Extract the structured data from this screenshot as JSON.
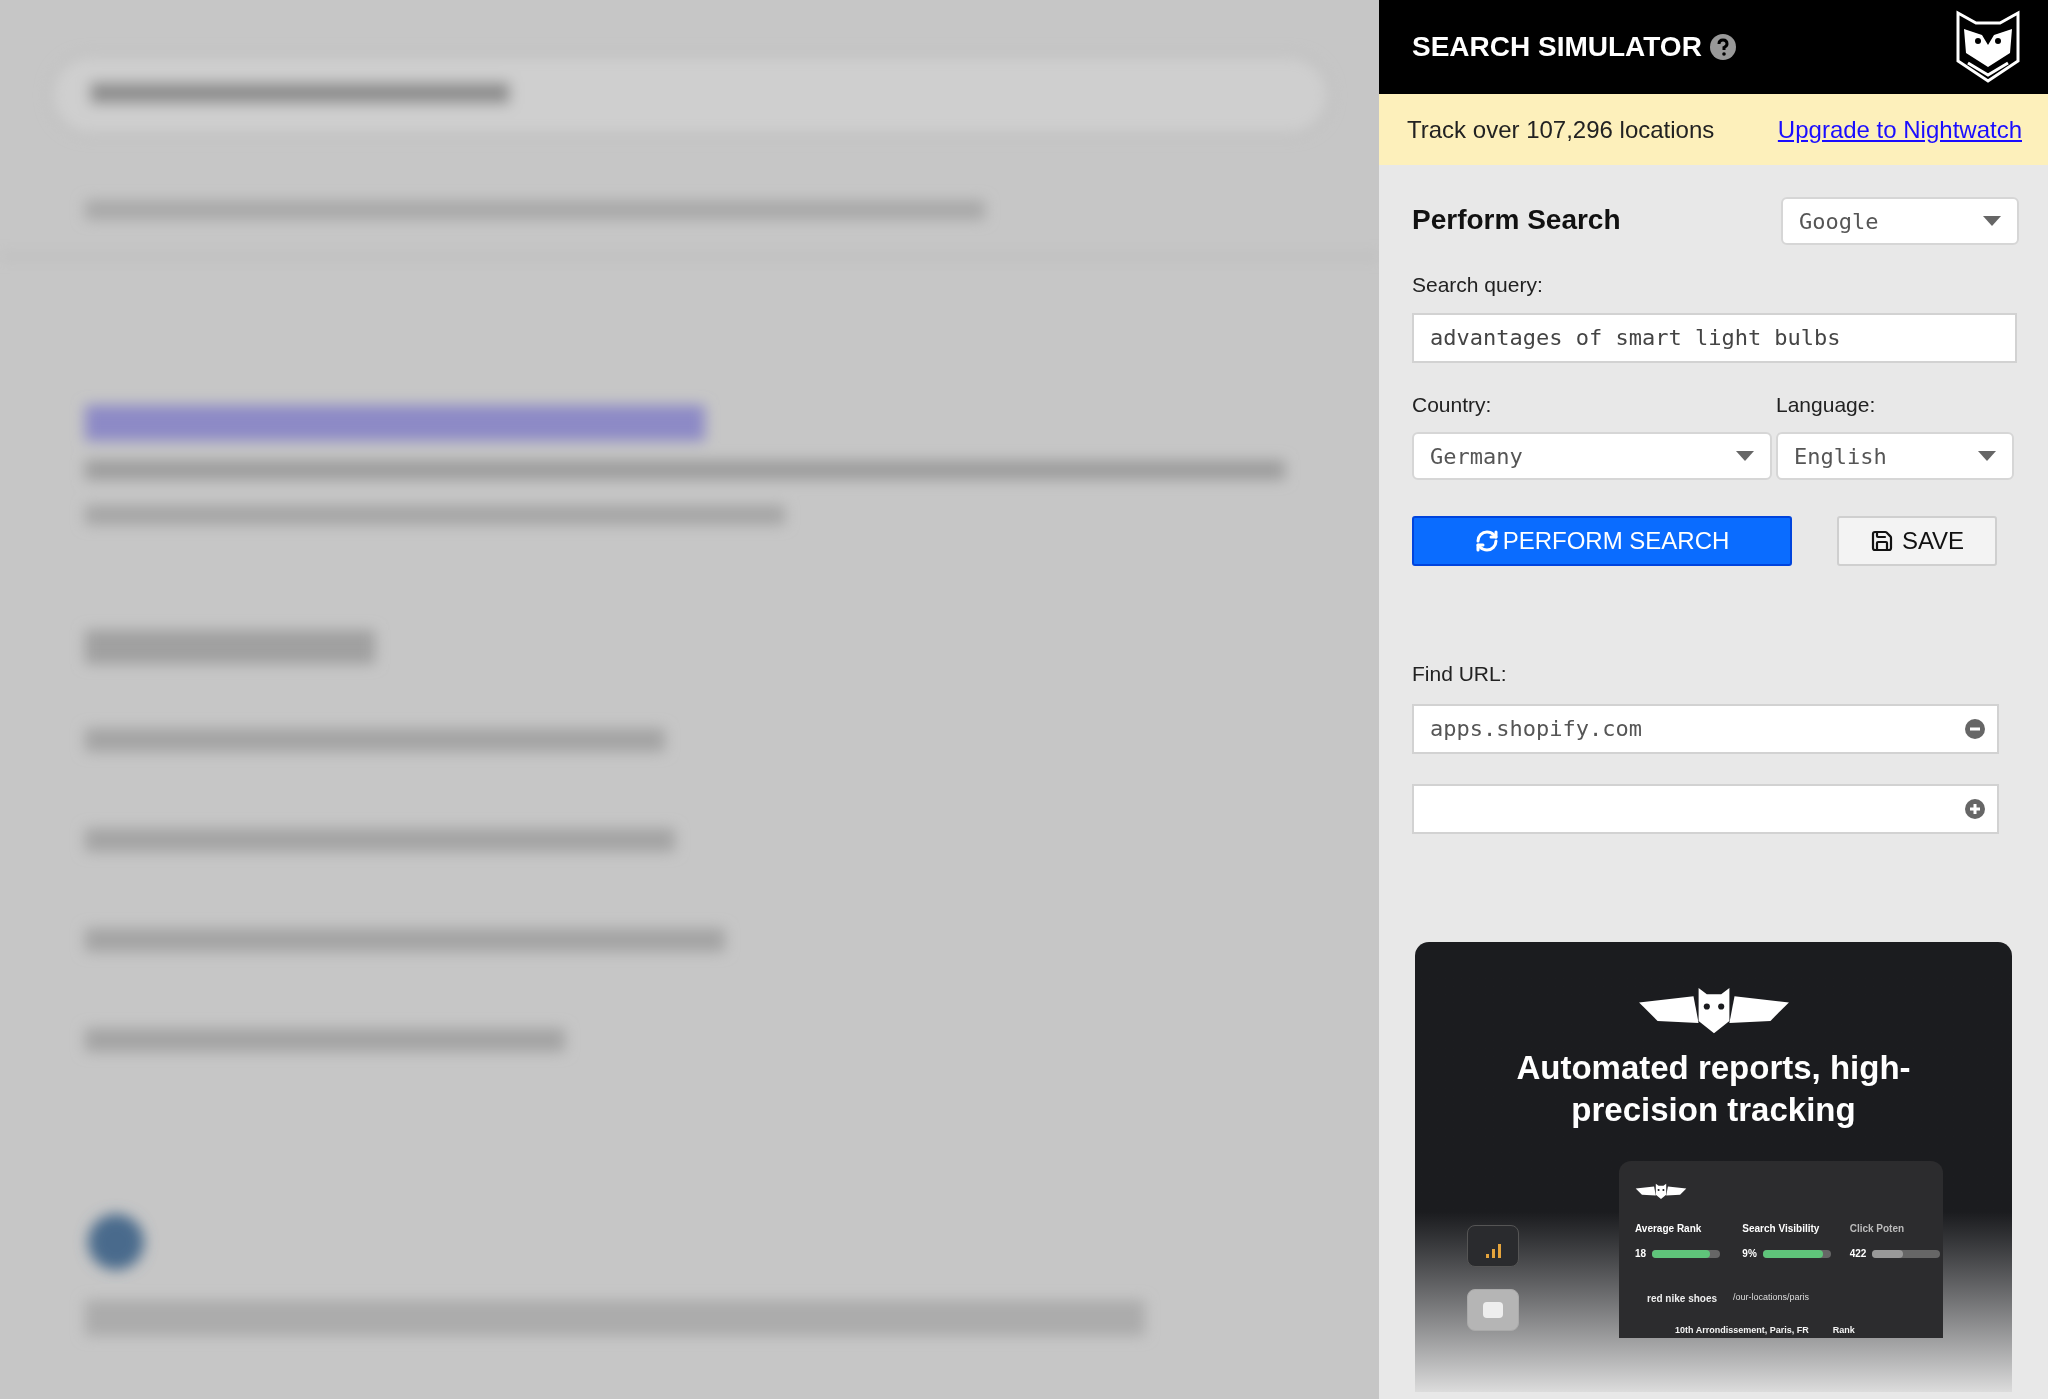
{
  "header": {
    "title": "SEARCH SIMULATOR"
  },
  "banner": {
    "text": "Track over 107,296 locations",
    "link": "Upgrade to Nightwatch"
  },
  "form": {
    "heading": "Perform Search",
    "engine": "Google",
    "query_label": "Search query:",
    "query": "advantages of smart light bulbs",
    "country_label": "Country:",
    "country": "Germany",
    "language_label": "Language:",
    "language": "English",
    "buttons": [
      {
        "kind": "primary",
        "label": "PERFORM SEARCH"
      },
      {
        "kind": "secondary",
        "label": "SAVE"
      }
    ],
    "find_url_label": "Find URL:",
    "urls": [
      {
        "kind": "remove",
        "value": "apps.shopify.com"
      },
      {
        "kind": "add"
      }
    ]
  },
  "promo": {
    "headline": "Automated reports, high-precision tracking",
    "metrics": [
      {
        "label": "Average Rank",
        "value": "18",
        "level": 0.85
      },
      {
        "label": "Search Visibility",
        "value": "9%",
        "level": 0.88
      },
      {
        "label": "Click Poten",
        "value": "422",
        "level": 0.45
      }
    ],
    "row": {
      "keyword": "red nike shoes",
      "path": "/our-locations/paris",
      "location": "10th Arrondissement, Paris, FR",
      "rank_label": "Rank"
    }
  }
}
